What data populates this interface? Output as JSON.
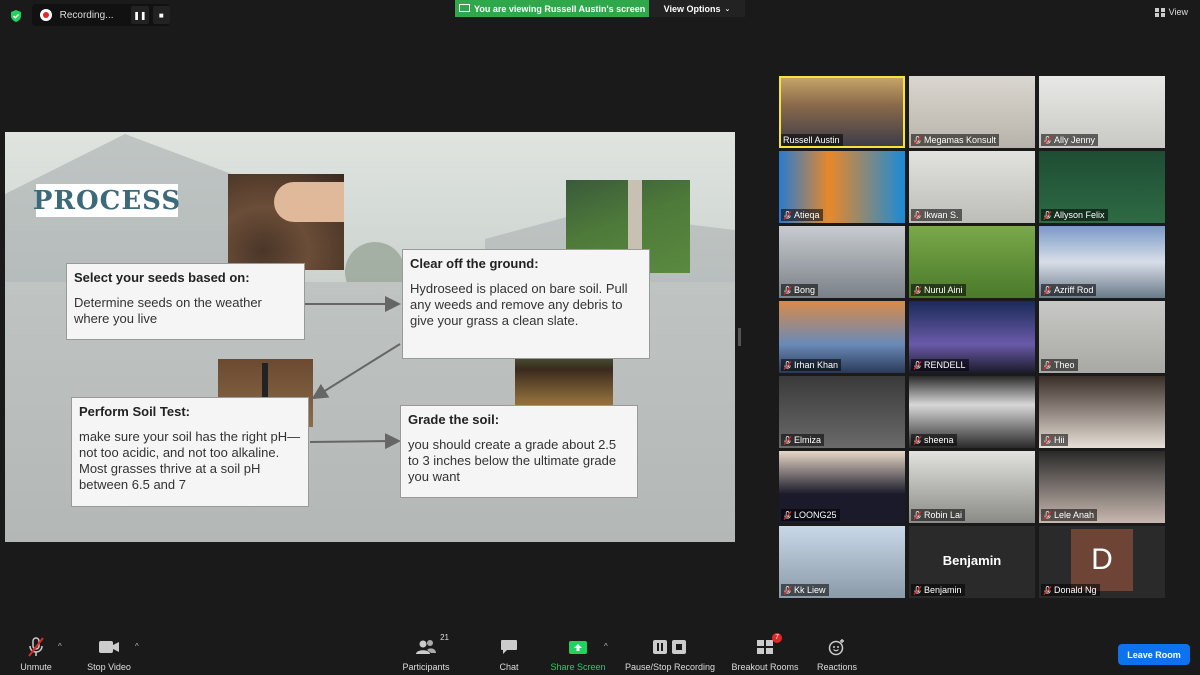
{
  "topbar": {
    "recording_label": "Recording...",
    "viewing_banner": "You are viewing Russell Austin's screen",
    "view_options_label": "View Options",
    "view_label": "View"
  },
  "slide": {
    "title": "PROCESS",
    "boxes": [
      {
        "heading": "Select your seeds based on:",
        "body": "Determine seeds on the weather where you live"
      },
      {
        "heading": "Clear off the ground:",
        "body": "Hydroseed is placed  on bare soil. Pull any weeds and remove any debris to give your grass a clean slate."
      },
      {
        "heading": "Perform Soil Test:",
        "body": "make sure your soil has the right pH—not too acidic, and not too alkaline. Most grasses thrive at a soil pH between 6.5 and 7"
      },
      {
        "heading": "Grade the soil:",
        "body": "you should create a grade about 2.5 to 3 inches below the ultimate grade you want"
      }
    ]
  },
  "participants": [
    {
      "name": "Russell Austin",
      "muted": false,
      "active": true
    },
    {
      "name": "Megamas Konsult",
      "muted": true
    },
    {
      "name": "Ally Jenny",
      "muted": true
    },
    {
      "name": "Atieqa",
      "muted": true
    },
    {
      "name": "Ikwan S.",
      "muted": true
    },
    {
      "name": "Allyson Felix",
      "muted": true
    },
    {
      "name": "Bong",
      "muted": true
    },
    {
      "name": "Nurul Aini",
      "muted": true
    },
    {
      "name": "Azriff Rod",
      "muted": true
    },
    {
      "name": "Irhan Khan",
      "muted": true
    },
    {
      "name": "RENDELL",
      "muted": true
    },
    {
      "name": "Theo",
      "muted": true
    },
    {
      "name": "Elmiza",
      "muted": true
    },
    {
      "name": "sheena",
      "muted": true
    },
    {
      "name": "Hii",
      "muted": true
    },
    {
      "name": "LOONG25",
      "muted": true
    },
    {
      "name": "Robin Lai",
      "muted": true
    },
    {
      "name": "Lele Anah",
      "muted": true
    },
    {
      "name": "Kk Liew",
      "muted": true
    },
    {
      "name": "Benjamin",
      "muted": true,
      "video_off": true
    },
    {
      "name": "Donald Ng",
      "muted": true,
      "avatar_letter": "D"
    }
  ],
  "toolbar": {
    "unmute": "Unmute",
    "stop_video": "Stop Video",
    "participants": "Participants",
    "participants_count": "21",
    "chat": "Chat",
    "share_screen": "Share Screen",
    "pause_stop_recording": "Pause/Stop Recording",
    "breakout_rooms": "Breakout Rooms",
    "breakout_badge": "7",
    "reactions": "Reactions",
    "leave_room": "Leave Room"
  },
  "colors": {
    "accent_green": "#23d160",
    "leave_blue": "#0e72ed",
    "active_border": "#f5e33a",
    "process_title": "#3d6a7a"
  }
}
